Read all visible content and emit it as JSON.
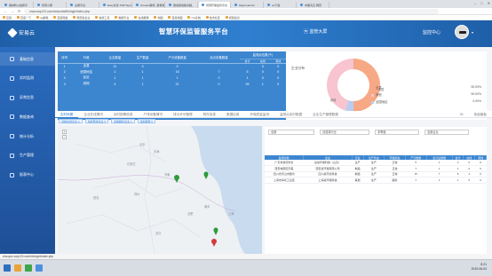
{
  "browser": {
    "tabs": [
      "森林防火指挥平",
      "智慧小屋",
      "主题平台",
      "Easy文化 TNR Signal",
      "zhuoaot移杯_易易新",
      "微友移动版卓越_",
      "智慧环保监管平台",
      "bilgurxuanrzn",
      "sa下载",
      "中国鸟云·网页"
    ],
    "active_tab": 6,
    "url": "www.aoy123.com/dw/portal/hb/login/index.php",
    "bookmarks": [
      "应用",
      "百度一下",
      "qq邮箱",
      "百度网盘",
      "网页版企业",
      "常用工具",
      "数据平台",
      "在线翻译",
      "地图",
      "百度地图",
      "OA系统",
      "技术社区",
      "视频会议"
    ]
  },
  "header": {
    "logo": "安易云",
    "title": "智慧环保监管服务平台",
    "screen_button": "监管大屏",
    "monitor_label": "监控中心"
  },
  "sidebar": {
    "items": [
      {
        "label": "基础信息",
        "icon": "database-icon"
      },
      {
        "label": "实时监测",
        "icon": "pulse-icon"
      },
      {
        "label": "异常信息",
        "icon": "alert-icon"
      },
      {
        "label": "数据查询",
        "icon": "search-icon"
      },
      {
        "label": "统计分析",
        "icon": "chart-icon"
      },
      {
        "label": "生产管理",
        "icon": "factory-icon"
      },
      {
        "label": "报表中心",
        "icon": "report-icon"
      }
    ],
    "active": 0
  },
  "stats": {
    "headers": [
      "序号",
      "行政",
      "企业数量",
      "生产数量",
      "产污设备数量",
      "治污设备数量",
      "监测点位数(个)"
    ],
    "sub_headers": [
      "合计",
      "在线",
      "离线"
    ],
    "rows": [
      [
        "1",
        "全县",
        "11",
        "0",
        "0",
        "",
        "",
        "0",
        "0"
      ],
      [
        "2",
        "全国地区",
        "1",
        "1",
        "16",
        "7",
        "5",
        "0",
        "0"
      ],
      [
        "3",
        "区区",
        "1",
        "1",
        "1",
        "0",
        "1",
        "0",
        "0"
      ],
      [
        "4",
        "其他",
        "4",
        "1",
        "21",
        "0",
        "26",
        "1",
        "0"
      ]
    ]
  },
  "distribution": {
    "title": "企业分布",
    "legend": [
      {
        "label": "全县",
        "value": "50.00%",
        "color": "#f7a884"
      },
      {
        "label": "其他",
        "value": "50.00%",
        "color": "#f7c4cf"
      },
      {
        "label": "全国地区",
        "value": "0.00%",
        "color": "#b9cdf2"
      }
    ],
    "donut_labels": [
      "全县",
      "其他"
    ],
    "shares": [
      0.5,
      0.05,
      0.45
    ]
  },
  "tabs": {
    "items": [
      "实时地图",
      "企业在线情况",
      "实时报警信息",
      "产排设备情况",
      "排污许可管理",
      "附件信息",
      "数据应用",
      "环境质量监测",
      "监测点实时数据",
      "企业生产管理数据"
    ],
    "active": 0,
    "right_label": "30",
    "right_action": "收起面板"
  },
  "filters": [
    "当前在线企业 4",
    "当前离线企业 0",
    "当前超标企业 1",
    "当前报警 0"
  ],
  "map": {
    "zoom_in": "+",
    "zoom_out": "−",
    "place_labels": [
      "北京",
      "天津",
      "石家庄",
      "济南",
      "郑州",
      "西安",
      "南京",
      "合肥",
      "上海",
      "武汉"
    ]
  },
  "right_panel": {
    "select1": "全部",
    "select2": "请选择行业",
    "select3": "本季度",
    "select4": "全部企业",
    "table_title": "监测点位数(个)",
    "columns": [
      "监测对象",
      "企业",
      "行业",
      "生产状态",
      "环保状态",
      "产污数量",
      "治污设施数",
      "合计",
      "在线",
      "离线"
    ],
    "rows": [
      [
        "广东省肇庆市泰",
        "某某环保科技（山东）",
        "生产",
        "生产",
        "正常",
        "5",
        "1",
        "3",
        "0",
        "0"
      ],
      [
        "西安城南区宇美",
        "西安某环保有限公司",
        "制造",
        "生产",
        "正常",
        "7",
        "1",
        "1",
        "0",
        "0"
      ],
      [
        "四川省乐山市犍为",
        "四川某环境科技",
        "制造",
        "生产",
        "正常",
        "15",
        "7",
        "5",
        "1",
        "0"
      ],
      [
        "上海市奉化工业区",
        "上海某环保科技",
        "其他",
        "生产",
        "超标",
        "1",
        "1",
        "1",
        "0",
        "0"
      ]
    ]
  },
  "statusbar": "zhuoyun.aoy123.com/hb/login/index.php",
  "clock": {
    "time": "8:21",
    "date": "2019-06-04"
  }
}
